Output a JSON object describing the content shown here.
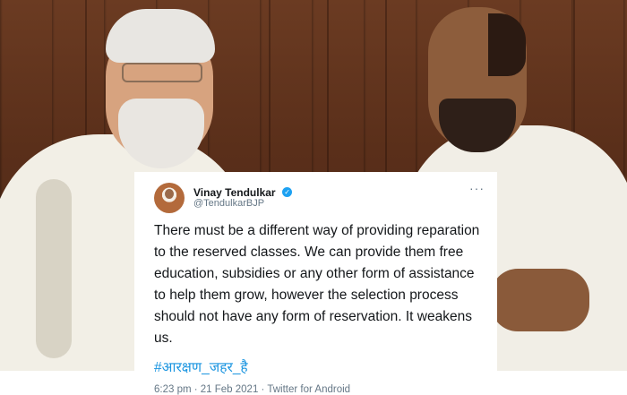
{
  "tweet": {
    "author_name": "Vinay Tendulkar",
    "handle": "@TendulkarBJP",
    "verified_icon": "check",
    "more_icon": "···",
    "text": "There must be a different way of providing reparation to the reserved classes. We can provide them free education, subsidies or any other form of assistance to help them grow, however the selection process should not have any form of reservation. It weakens us.",
    "hashtag": "#आरक्षण_जहर_है",
    "meta": "6:23 pm · 21 Feb 2021 · Twitter for Android"
  },
  "colors": {
    "link": "#1b95e0",
    "verified": "#1da1f2",
    "text": "#14171a",
    "muted": "#657786"
  }
}
